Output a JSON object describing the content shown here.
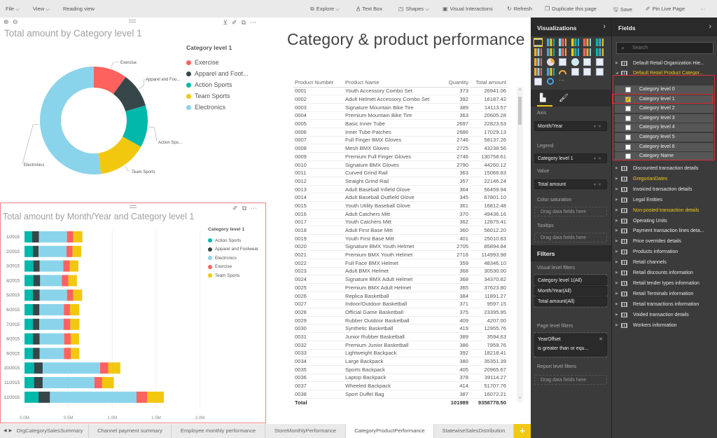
{
  "menu": {
    "file": "File",
    "view": "View",
    "reading_view": "Reading view",
    "explore": "Explore",
    "text_box": "Text Box",
    "shapes": "Shapes",
    "visual_interactions": "Visual Interactions",
    "refresh": "Refresh",
    "duplicate_page": "Duplicate this page",
    "save": "Save",
    "pin_live_page": "Pin Live Page",
    "more": "···"
  },
  "page_title": "Category & product performance",
  "donut": {
    "title": "Total amount by Category level 1",
    "legend_title": "Category level 1",
    "legend": [
      {
        "label": "Exercise",
        "color": "#fd625e"
      },
      {
        "label": "Apparel and Foot...",
        "color": "#374649"
      },
      {
        "label": "Action Sports",
        "color": "#01b8aa"
      },
      {
        "label": "Team Sports",
        "color": "#f2c80f"
      },
      {
        "label": "Electronics",
        "color": "#8ad4eb"
      }
    ],
    "slice_labels": [
      "Exercise",
      "Apparel and Foo...",
      "Action Spo...",
      "Team Sports",
      "Electronics"
    ]
  },
  "bar": {
    "title": "Total amount by Month/Year and Category level 1",
    "legend_title": "Category level 1",
    "legend": [
      {
        "label": "Action Sports",
        "color": "#01b8aa"
      },
      {
        "label": "Apparel and Footwear",
        "color": "#374649"
      },
      {
        "label": "Electronics",
        "color": "#8ad4eb"
      },
      {
        "label": "Exercise",
        "color": "#fd625e"
      },
      {
        "label": "Team Sports",
        "color": "#f2c80f"
      }
    ]
  },
  "chart_data": [
    {
      "type": "pie",
      "title": "Total amount by Category level 1",
      "legend_title": "Category level 1",
      "legend_position": "right",
      "categories": [
        "Exercise",
        "Apparel and Footwear",
        "Action Sports",
        "Team Sports",
        "Electronics"
      ],
      "values": [
        10.1,
        10.4,
        12.6,
        14.8,
        52.1
      ],
      "unit": "percent of total (estimated)",
      "colors": [
        "#fd625e",
        "#374649",
        "#01b8aa",
        "#f2c80f",
        "#8ad4eb"
      ],
      "donut": true
    },
    {
      "type": "bar",
      "orientation": "horizontal",
      "stacked": true,
      "title": "Total amount by Month/Year and Category level 1",
      "legend_title": "Category level 1",
      "legend_position": "right",
      "categories": [
        "1/2015",
        "2/2015",
        "3/2015",
        "4/2015",
        "5/2015",
        "6/2015",
        "7/2015",
        "8/2015",
        "9/2015",
        "10/2015",
        "11/2015",
        "12/2015"
      ],
      "xlim": [
        0,
        2.4
      ],
      "xticks": [
        "0.0M",
        "0.5M",
        "1.0M",
        "1.5M",
        "2.0M"
      ],
      "xtick_values": [
        0,
        0.5,
        1.0,
        1.5,
        2.0
      ],
      "grid": true,
      "unit": "millions",
      "series": [
        {
          "name": "Action Sports",
          "color": "#01b8aa",
          "values": [
            0.088,
            0.096,
            0.101,
            0.101,
            0.096,
            0.096,
            0.096,
            0.096,
            0.096,
            0.109,
            0.109,
            0.16
          ]
        },
        {
          "name": "Apparel and Footwear",
          "color": "#374649",
          "values": [
            0.077,
            0.064,
            0.072,
            0.077,
            0.077,
            0.074,
            0.072,
            0.077,
            0.077,
            0.098,
            0.098,
            0.13
          ]
        },
        {
          "name": "Electronics",
          "color": "#8ad4eb",
          "values": [
            0.319,
            0.319,
            0.269,
            0.247,
            0.311,
            0.279,
            0.277,
            0.279,
            0.277,
            0.654,
            0.59,
            0.987
          ]
        },
        {
          "name": "Exercise",
          "color": "#fd625e",
          "values": [
            0.072,
            0.069,
            0.074,
            0.074,
            0.072,
            0.069,
            0.077,
            0.074,
            0.077,
            0.093,
            0.088,
            0.122
          ]
        },
        {
          "name": "Team Sports",
          "color": "#f2c80f",
          "values": [
            0.104,
            0.098,
            0.098,
            0.098,
            0.101,
            0.106,
            0.104,
            0.096,
            0.098,
            0.138,
            0.133,
            0.189
          ]
        }
      ]
    }
  ],
  "table": {
    "columns": [
      "Product Number",
      "Product Name",
      "Quantity",
      "Total amount"
    ],
    "rows": [
      [
        "0001",
        "Youth Accessory Combo Set",
        "373",
        "26941.06"
      ],
      [
        "0002",
        "Adult Helmet Accessory Combo Set",
        "392",
        "16187.42"
      ],
      [
        "0003",
        "Signature Mountain Bike Tire",
        "389",
        "14113.57"
      ],
      [
        "0004",
        "Premium Mountain Bike Tire",
        "363",
        "20605.28"
      ],
      [
        "0005",
        "Basic Inner Tube",
        "2697",
        "22823.53"
      ],
      [
        "0006",
        "Inner Tube Patches",
        "2686",
        "17029.13"
      ],
      [
        "0007",
        "Full Finger BMX Gloves",
        "2746",
        "58137.26"
      ],
      [
        "0008",
        "Mesh BMX Gloves",
        "2725",
        "43238.56"
      ],
      [
        "0009",
        "Premium Full Finger Gloves",
        "2746",
        "130758.61"
      ],
      [
        "0010",
        "Signature BMX Gloves",
        "2790",
        "44260.12"
      ],
      [
        "0011",
        "Curved Grind Rail",
        "363",
        "15066.83"
      ],
      [
        "0012",
        "Straight Grind Rail",
        "357",
        "22146.24"
      ],
      [
        "0013",
        "Adult Baseball Infield Glove",
        "364",
        "56459.94"
      ],
      [
        "0014",
        "Adult Baseball Outfield Glove",
        "345",
        "67801.10"
      ],
      [
        "0015",
        "Youth Utility Baseball Glove",
        "361",
        "16812.48"
      ],
      [
        "0016",
        "Adult Catchers Mitt",
        "370",
        "49436.16"
      ],
      [
        "0017",
        "Youth Catchers Mitt",
        "362",
        "12875.41"
      ],
      [
        "0018",
        "Adult First Base Mitt",
        "360",
        "56012.20"
      ],
      [
        "0019",
        "Youth First Base Mitt",
        "401",
        "25010.83"
      ],
      [
        "0020",
        "Signature BMX Youth Helmet",
        "2705",
        "85894.84"
      ],
      [
        "0021",
        "Premium BMX Youth Helmet",
        "2716",
        "114993.98"
      ],
      [
        "0022",
        "Full Face BMX Helmet",
        "359",
        "48346.10"
      ],
      [
        "0023",
        "Adult BMX Helmet",
        "368",
        "30530.00"
      ],
      [
        "0024",
        "Signature BMX Adult Helmet",
        "368",
        "34370.82"
      ],
      [
        "0025",
        "Premium BMX Adult Helmet",
        "365",
        "37623.80"
      ],
      [
        "0026",
        "Replica Basketball",
        "384",
        "11891.27"
      ],
      [
        "0027",
        "Indoor/Outdoor Basketball",
        "371",
        "9597.15"
      ],
      [
        "0028",
        "Official Game Basketball",
        "375",
        "23395.95"
      ],
      [
        "0029",
        "Rubber Outdoor Basketball",
        "409",
        "4207.00"
      ],
      [
        "0030",
        "Synthetic Basketball",
        "419",
        "12955.76"
      ],
      [
        "0031",
        "Junior Rubber Basketball",
        "389",
        "3594.63"
      ],
      [
        "0032",
        "Premium Junior Basketball",
        "386",
        "7959.76"
      ],
      [
        "0033",
        "Lightweight Backpack",
        "392",
        "18218.41"
      ],
      [
        "0034",
        "Large Backpack",
        "380",
        "35351.39"
      ],
      [
        "0035",
        "Sports Backpack",
        "405",
        "20965.67"
      ],
      [
        "0036",
        "Laptop Backpack",
        "378",
        "39114.27"
      ],
      [
        "0037",
        "Wheeled Backpack",
        "414",
        "51707.76"
      ],
      [
        "0038",
        "Sport Duffel Bag",
        "387",
        "16072.21"
      ]
    ],
    "total": [
      "Total",
      "",
      "101989",
      "9358778.50"
    ]
  },
  "tabs": [
    {
      "label": "OrgCategorySalesSummary",
      "active": false
    },
    {
      "label": "Channel payment summary",
      "active": false
    },
    {
      "label": "Employee monthly performance",
      "active": false
    },
    {
      "label": "StoreMonthlyPerformance",
      "active": false
    },
    {
      "label": "CategoryProductPerformance",
      "active": true
    },
    {
      "label": "StatewiseSalesDistribution",
      "active": false
    }
  ],
  "add_tab": "+",
  "visualizations": {
    "title": "Visualizations",
    "wells": [
      {
        "label": "Axis",
        "value": "Month/Year"
      },
      {
        "label": "Legend",
        "value": "Category level 1"
      },
      {
        "label": "Value",
        "value": "Total amount"
      },
      {
        "label": "Color saturation",
        "value": "Drag data fields here"
      },
      {
        "label": "Tooltips",
        "value": "Drag data fields here"
      }
    ]
  },
  "filters": {
    "title": "Filters",
    "visual_level_label": "Visual level filters",
    "visual_level": [
      "Category level 1(All)",
      "Month/Year(All)",
      "Total amount(All)"
    ],
    "page_level_label": "Page level filters",
    "page_level": {
      "field": "YearOffset",
      "condition": "is greater than or equ..."
    },
    "report_level_label": "Report level filters",
    "report_level_placeholder": "Drag data fields here"
  },
  "fields": {
    "title": "Fields",
    "search_placeholder": "Search",
    "tables_top": [
      {
        "name": "Default Retail Organization Hie...",
        "highlight": false,
        "expanded": false
      },
      {
        "name": "Default Retail Product Categor...",
        "highlight": true,
        "expanded": true
      }
    ],
    "sub_fields": [
      {
        "name": "Category level 0",
        "checked": false
      },
      {
        "name": "Category level 1",
        "checked": true
      },
      {
        "name": "Category level 2",
        "checked": false
      },
      {
        "name": "Category level 3",
        "checked": false
      },
      {
        "name": "Category level 4",
        "checked": false
      },
      {
        "name": "Category level 5",
        "checked": false
      },
      {
        "name": "Category level 6",
        "checked": false
      },
      {
        "name": "Category Name",
        "checked": false
      }
    ],
    "tables": [
      {
        "name": "Discounted transaction details",
        "highlight": false
      },
      {
        "name": "GregorianDates",
        "highlight": true
      },
      {
        "name": "Invoiced transaction details",
        "highlight": false
      },
      {
        "name": "Legal Entities",
        "highlight": false
      },
      {
        "name": "Non-posted transaction details",
        "highlight": true
      },
      {
        "name": "Operating Units",
        "highlight": false
      },
      {
        "name": "Payment transaction lines deta...",
        "highlight": false
      },
      {
        "name": "Price overrides details",
        "highlight": false
      },
      {
        "name": "Products information",
        "highlight": false
      },
      {
        "name": "Retail channels",
        "highlight": false
      },
      {
        "name": "Retail discounts information",
        "highlight": false
      },
      {
        "name": "Retail tender types information",
        "highlight": false
      },
      {
        "name": "Retail Terminals information",
        "highlight": false
      },
      {
        "name": "Retail transactions information",
        "highlight": false
      },
      {
        "name": "Voided transaction details",
        "highlight": false
      },
      {
        "name": "Workers information",
        "highlight": false
      }
    ]
  }
}
